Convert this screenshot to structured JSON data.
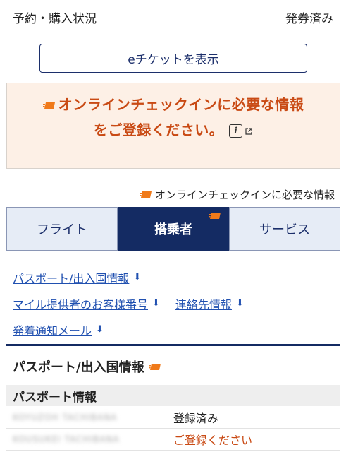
{
  "status": {
    "label": "予約・購入状況",
    "value": "発券済み"
  },
  "eticket": {
    "label": "eチケットを表示"
  },
  "notice": {
    "line1": "オンラインチェックインに必要な情報",
    "line2": "をご登録ください。",
    "info_icon": "i"
  },
  "legend": {
    "label": "オンラインチェックインに必要な情報"
  },
  "tabs": [
    {
      "label": "フライト",
      "active": false
    },
    {
      "label": "搭乗者",
      "active": true
    },
    {
      "label": "サービス",
      "active": false
    }
  ],
  "links": {
    "passport": "パスポート/出入国情報",
    "mileage": "マイル提供者のお客様番号",
    "contact": "連絡先情報",
    "notify": "発着通知メール"
  },
  "section": {
    "title": "パスポート/出入国情報"
  },
  "passport_table": {
    "header": "パスポート情報",
    "rows": [
      {
        "name": "KOYUZOH TACHIBANA",
        "status": "登録済み"
      },
      {
        "name": "KOUSUKEI TACHIBANA",
        "status": "ご登録ください"
      }
    ]
  },
  "colors": {
    "navy": "#142b63",
    "accent": "#c94a14",
    "notice_bg": "#fdf0e6",
    "link": "#2050b0",
    "ticket_icon": "#f07a1a"
  }
}
